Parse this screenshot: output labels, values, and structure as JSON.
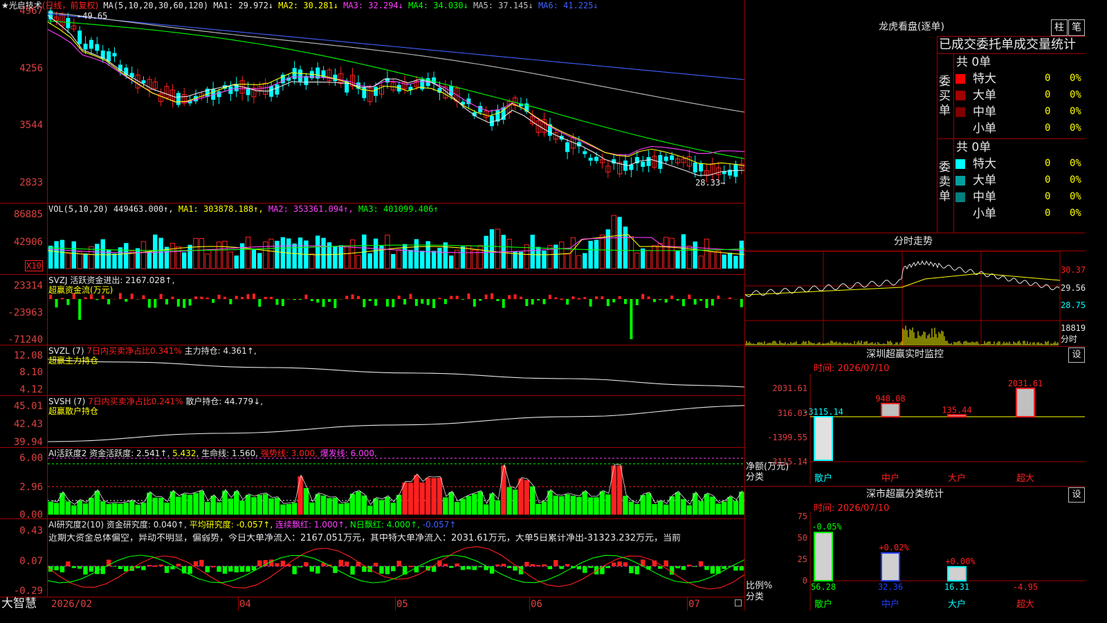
{
  "colors": {
    "up": "#ff2020",
    "down": "#00ffff",
    "grid": "#a00000",
    "axis": "#e04040"
  },
  "main": {
    "title": "★光启技术",
    "title_mode": "(日线，前复权)",
    "ma_header": "MA(5,10,20,30,60,120)",
    "ma_items": [
      {
        "text": "MA1: 29.972↓",
        "color": "#e6e6e6"
      },
      {
        "text": "MA2: 30.281↓",
        "color": "#ffff00"
      },
      {
        "text": "MA3: 32.294↓",
        "color": "#ff40ff"
      },
      {
        "text": "MA4: 34.030↓",
        "color": "#00ff00"
      },
      {
        "text": "MA5: 37.145↓",
        "color": "#c0c0c0"
      },
      {
        "text": "MA6: 41.225↓",
        "color": "#4060ff"
      }
    ],
    "high_label": "←49.65",
    "low_label": "28.33→",
    "y_labels": [
      "4967",
      "4256",
      "3544",
      "2833"
    ]
  },
  "vol": {
    "header": "VOL(5,10,20)",
    "items": [
      {
        "text": "449463.000↑,",
        "color": "#e6e6e6"
      },
      {
        "text": "MA1: 303878.188↑,",
        "color": "#ffff00"
      },
      {
        "text": "MA2: 353361.094↑,",
        "color": "#ff40ff"
      },
      {
        "text": "MA3: 401099.406↑",
        "color": "#00ff00"
      }
    ],
    "y_labels": [
      "86885",
      "42906"
    ],
    "unit": "X10"
  },
  "svzj": {
    "header": "SVZJ  活跃资金进出: 2167.028↑,",
    "sub": "超赢资金流(万元)",
    "y_labels": [
      "23314",
      "-23963",
      "-71240"
    ]
  },
  "svzl": {
    "header1": "SVZL (7)",
    "header2": "7日内买卖净占比0.341%",
    "header3": "主力持仓: 4.361↑,",
    "sub": "超赢主力持仓",
    "y_labels": [
      "12.08",
      "8.10",
      "4.12"
    ]
  },
  "svsh": {
    "header1": "SVSH (7)",
    "header2": "7日内买卖净占比0.241%",
    "header3": "散户持仓: 44.779↓,",
    "sub": "超赢散户持仓",
    "y_labels": [
      "45.01",
      "42.43",
      "39.94"
    ]
  },
  "ai_active": {
    "items": [
      {
        "text": "AI活跃度2 资金活跃度: 2.541↑,",
        "color": "#e6e6e6"
      },
      {
        "text": "5.432,",
        "color": "#ffff00"
      },
      {
        "text": "生命线: 1.560,",
        "color": "#e6e6e6"
      },
      {
        "text": "强势线: 3.000,",
        "color": "#ff2020"
      },
      {
        "text": "爆发线: 6.000,",
        "color": "#ff40ff"
      }
    ],
    "y_labels": [
      "6.00",
      "2.96",
      "0.00"
    ]
  },
  "ai_research": {
    "items": [
      {
        "text": "AI研究度2(10) 资金研究度: 0.040↑,",
        "color": "#e6e6e6"
      },
      {
        "text": "平均研究度: -0.057↑,",
        "color": "#ffff00"
      },
      {
        "text": "连续飘红: 1.000↑,",
        "color": "#ff40ff"
      },
      {
        "text": "N日飘红: 4.000↑,",
        "color": "#00ff00"
      },
      {
        "text": "-0.057↑",
        "color": "#4060ff"
      }
    ],
    "comment": "近期大资金总体偏空，异动不明显，偏弱势，今日大单净流入：2167.051万元，其中特大单净流入：2031.61万元，大单5日累计净出-31323.232万元，当前",
    "y_labels": [
      "0.43",
      "0.07",
      "-0.29"
    ]
  },
  "xaxis": {
    "brand": "大智慧",
    "labels": [
      "2026/02",
      "04",
      "05",
      "06",
      "07"
    ]
  },
  "right": {
    "lhb_title": "龙虎看盘(逐单)",
    "btn_bar": "柱",
    "btn_pen": "笔",
    "orders_title": "已成交委托单成交量统计",
    "buy": {
      "label": "委买单",
      "total": "共 0单",
      "rows": [
        {
          "name": "特大",
          "val": "0",
          "pct": "0%",
          "color": "#ff0000"
        },
        {
          "name": "大单",
          "val": "0",
          "pct": "0%",
          "color": "#a00000"
        },
        {
          "name": "中单",
          "val": "0",
          "pct": "0%",
          "color": "#800000"
        },
        {
          "name": "小单",
          "val": "0",
          "pct": "0%",
          "color": "#000000"
        }
      ]
    },
    "sell": {
      "label": "委卖单",
      "total": "共 0单",
      "rows": [
        {
          "name": "特大",
          "val": "0",
          "pct": "0%",
          "color": "#00ffff"
        },
        {
          "name": "大单",
          "val": "0",
          "pct": "0%",
          "color": "#00a0a0"
        },
        {
          "name": "中单",
          "val": "0",
          "pct": "0%",
          "color": "#008080"
        },
        {
          "name": "小单",
          "val": "0",
          "pct": "0%",
          "color": "#000000"
        }
      ]
    },
    "intraday_title": "分时走势",
    "intraday_prices": [
      "30.37",
      "29.56",
      "28.75"
    ],
    "intraday_vol": "18819",
    "intraday_vol2": "分时",
    "sz_monitor": {
      "title": "深圳超赢实时监控",
      "btn": "设",
      "time": "时间: 2026/07/10",
      "y_labels": [
        "2031.61",
        "316.03",
        "-1399.55",
        "-3115.14"
      ],
      "ylabel1": "净额(万元)",
      "ylabel2": "分类",
      "bars": [
        {
          "cat": "散户",
          "value": -3115.14,
          "label": "-3115.14",
          "color": "#00ffff"
        },
        {
          "cat": "中户",
          "value": 948.08,
          "label": "948.08",
          "color": "#ff2020"
        },
        {
          "cat": "大户",
          "value": 135.44,
          "label": "135.44",
          "color": "#ff2020"
        },
        {
          "cat": "超大",
          "value": 2031.61,
          "label": "2031.61",
          "color": "#ff2020"
        }
      ]
    },
    "sz_class": {
      "title": "深市超赢分类统计",
      "btn": "设",
      "time": "时间: 2026/07/10",
      "y_labels": [
        "75",
        "50",
        "25",
        "0"
      ],
      "ylabel1": "比例%",
      "ylabel2": "分类",
      "bars": [
        {
          "cat": "散户",
          "value": 56.28,
          "top": "-0.05%",
          "bottom": "56.28",
          "color": "#00ff00"
        },
        {
          "cat": "中户",
          "value": 32.36,
          "top": "+0.02%",
          "bottom": "32.36",
          "color": "#2040ff"
        },
        {
          "cat": "大户",
          "value": 16.31,
          "top": "+0.00%",
          "bottom": "16.31",
          "color": "#00ffff"
        },
        {
          "cat": "超大",
          "value": -4.95,
          "top": "",
          "bottom": "-4.95",
          "color": "#ff2020"
        }
      ]
    }
  }
}
